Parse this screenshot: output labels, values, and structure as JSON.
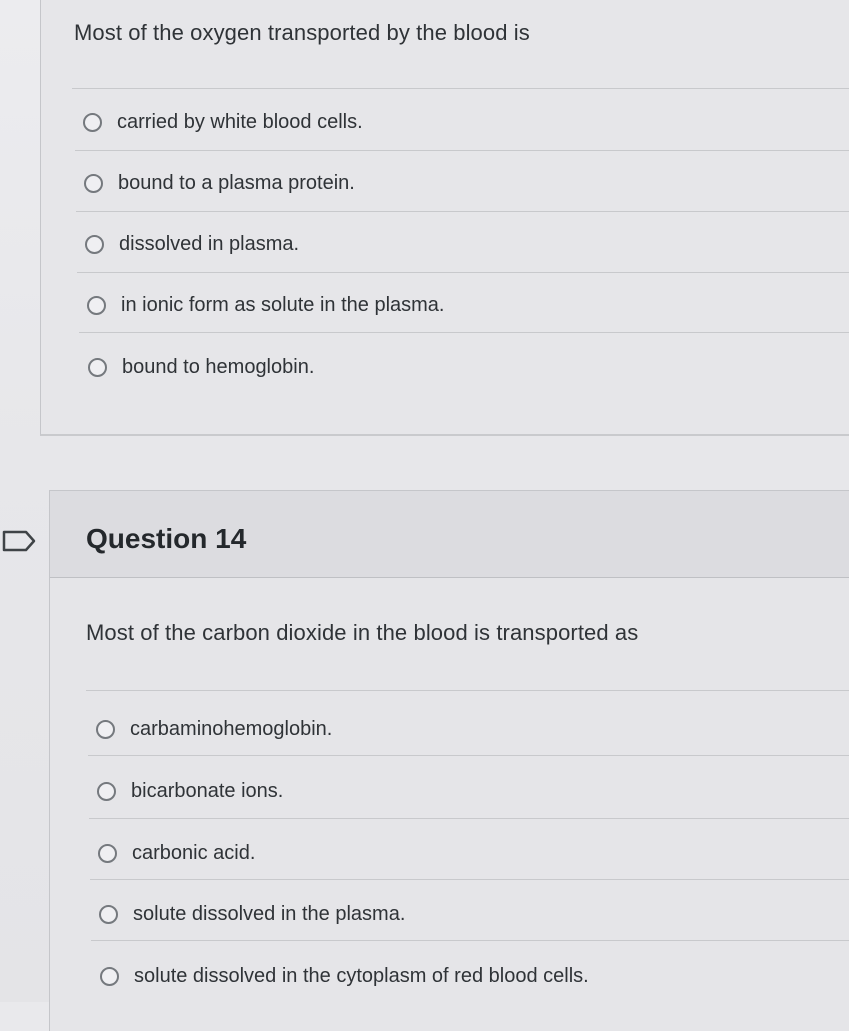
{
  "question13": {
    "prompt": "Most of the oxygen transported by the blood is",
    "answers": [
      {
        "label": "carried by white blood cells."
      },
      {
        "label": "bound to a plasma protein."
      },
      {
        "label": "dissolved in plasma."
      },
      {
        "label": "in ionic form as solute in the plasma."
      },
      {
        "label": "bound to hemoglobin."
      }
    ]
  },
  "question14": {
    "title": "Question 14",
    "prompt": "Most of the carbon dioxide in the blood is transported as",
    "answers": [
      {
        "label": "carbaminohemoglobin."
      },
      {
        "label": "bicarbonate ions."
      },
      {
        "label": "carbonic acid."
      },
      {
        "label": "solute dissolved in the plasma."
      },
      {
        "label": "solute dissolved in the cytoplasm of red blood cells."
      }
    ]
  },
  "icons": {
    "flag": "flag-outline-icon",
    "radio": "radio-unselected-icon"
  },
  "colors": {
    "background": "#e9e9ec",
    "text": "#2f3337",
    "radio_border": "#75797e",
    "divider": "#c8c9cc",
    "header": "#dcdce0"
  }
}
